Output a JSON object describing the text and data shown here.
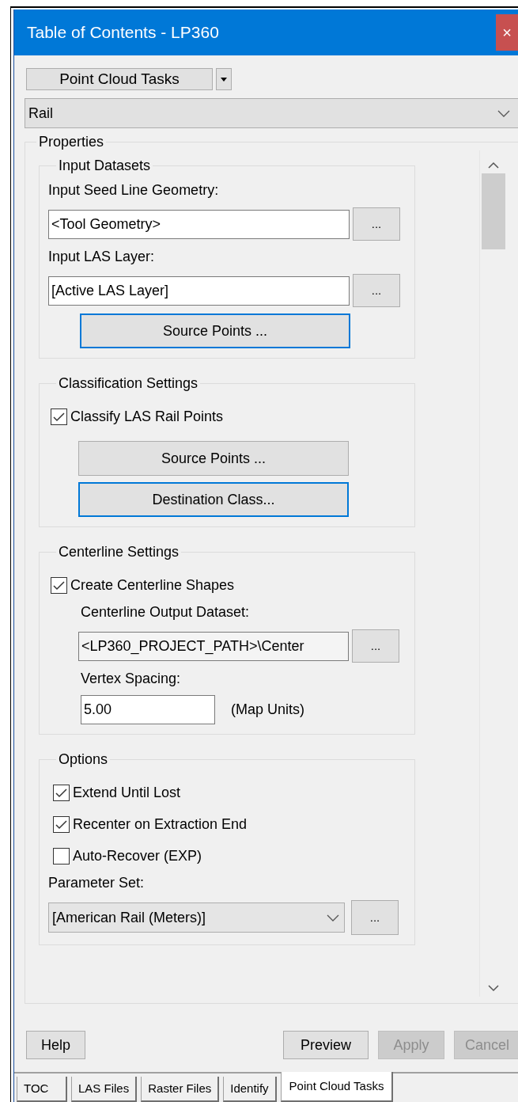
{
  "window": {
    "title": "Table of Contents - LP360",
    "close_label": "×"
  },
  "task_button": {
    "label": "Point Cloud Tasks"
  },
  "task_select": {
    "value": "Rail"
  },
  "properties": {
    "title": "Properties",
    "groups": [
      {
        "title": "Input Datasets",
        "items": [
          {
            "kind": "label",
            "text": "Input Seed Line Geometry:"
          },
          {
            "kind": "path",
            "value": "<Tool Geometry>",
            "browse": "..."
          },
          {
            "kind": "label",
            "text": "Input LAS Layer:"
          },
          {
            "kind": "path",
            "value": "[Active LAS Layer]",
            "browse": "..."
          },
          {
            "kind": "button",
            "label": "Source Points ...",
            "focused": true
          }
        ]
      },
      {
        "title": "Classification Settings",
        "items": [
          {
            "kind": "checkbox",
            "label": "Classify LAS Rail Points",
            "checked": true,
            "children": [
              {
                "kind": "button",
                "label": "Source Points ...",
                "focused": false
              },
              {
                "kind": "button",
                "label": "Destination Class...",
                "focused": true
              }
            ]
          }
        ]
      },
      {
        "title": "Centerline Settings",
        "items": [
          {
            "kind": "checkbox",
            "label": "Create Centerline Shapes",
            "checked": true,
            "children": [
              {
                "kind": "label",
                "text": "Centerline Output Dataset:"
              },
              {
                "kind": "path",
                "value": "<LP360_PROJECT_PATH>\\Center",
                "browse": "..."
              },
              {
                "kind": "label",
                "text": "Vertex Spacing:"
              },
              {
                "kind": "number",
                "value": "5.00",
                "unit": "(Map Units)"
              }
            ]
          }
        ]
      },
      {
        "title": "Options",
        "items": [
          {
            "kind": "checkbox",
            "label": "Extend Until Lost",
            "checked": true
          },
          {
            "kind": "checkbox",
            "label": "Recenter on Extraction End",
            "checked": true
          },
          {
            "kind": "checkbox",
            "label": "Auto-Recover (EXP)",
            "checked": false
          },
          {
            "kind": "label",
            "text": "Parameter Set:"
          },
          {
            "kind": "select",
            "value": "[American Rail (Meters)]",
            "browse": "..."
          }
        ]
      }
    ]
  },
  "help_button": {
    "label": "Help",
    "disabled": false
  },
  "action_buttons": [
    {
      "label": "Preview",
      "disabled": false
    },
    {
      "label": "Apply",
      "disabled": true
    },
    {
      "label": "Cancel",
      "disabled": true
    }
  ],
  "tabs": [
    {
      "label": "TOC",
      "selected": false
    },
    {
      "label": "LAS Files",
      "selected": false
    },
    {
      "label": "Raster Files",
      "selected": false
    },
    {
      "label": "Identify",
      "selected": false
    },
    {
      "label": "Point Cloud Tasks",
      "selected": true
    }
  ]
}
